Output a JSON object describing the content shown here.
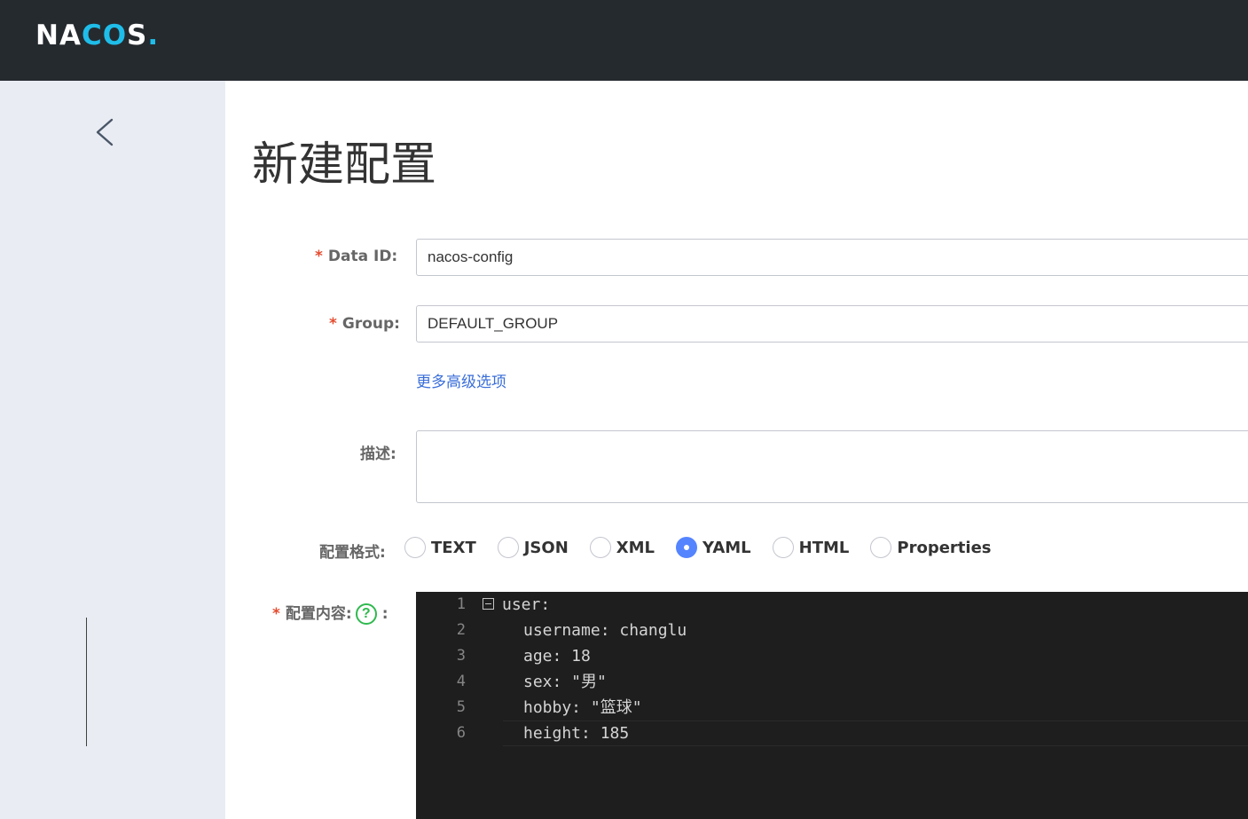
{
  "header": {
    "logo_text_a": "NA",
    "logo_text_b": "CO",
    "logo_text_c": "S",
    "logo_dot": "."
  },
  "sidebar": {
    "back_icon": "chevron-left-icon"
  },
  "page": {
    "title": "新建配置"
  },
  "form": {
    "required_mark": "*",
    "data_id": {
      "label": "Data ID:",
      "value": "nacos-config"
    },
    "group": {
      "label": "Group:",
      "value": "DEFAULT_GROUP"
    },
    "advanced_link": "更多高级选项",
    "description": {
      "label": "描述:",
      "value": ""
    },
    "format": {
      "label": "配置格式:",
      "options": [
        "TEXT",
        "JSON",
        "XML",
        "YAML",
        "HTML",
        "Properties"
      ],
      "selected": "YAML"
    },
    "content": {
      "label": "配置内容:",
      "help_icon": "question-circle-icon",
      "colon": ":"
    }
  },
  "editor": {
    "lines": [
      {
        "n": "1",
        "text": "user:"
      },
      {
        "n": "2",
        "text": "username: changlu"
      },
      {
        "n": "3",
        "text": "age: 18"
      },
      {
        "n": "4",
        "text": "sex: \"男\""
      },
      {
        "n": "5",
        "text": "hobby: \"篮球\""
      },
      {
        "n": "6",
        "text": "height: 185"
      }
    ]
  },
  "colors": {
    "topbar": "#252a2f",
    "sidebar": "#e9edf3",
    "accent": "#5584ff",
    "link": "#3a6ed9",
    "required": "#e54b2f",
    "help": "#2fb94e",
    "editor_bg": "#1e1e1e"
  }
}
